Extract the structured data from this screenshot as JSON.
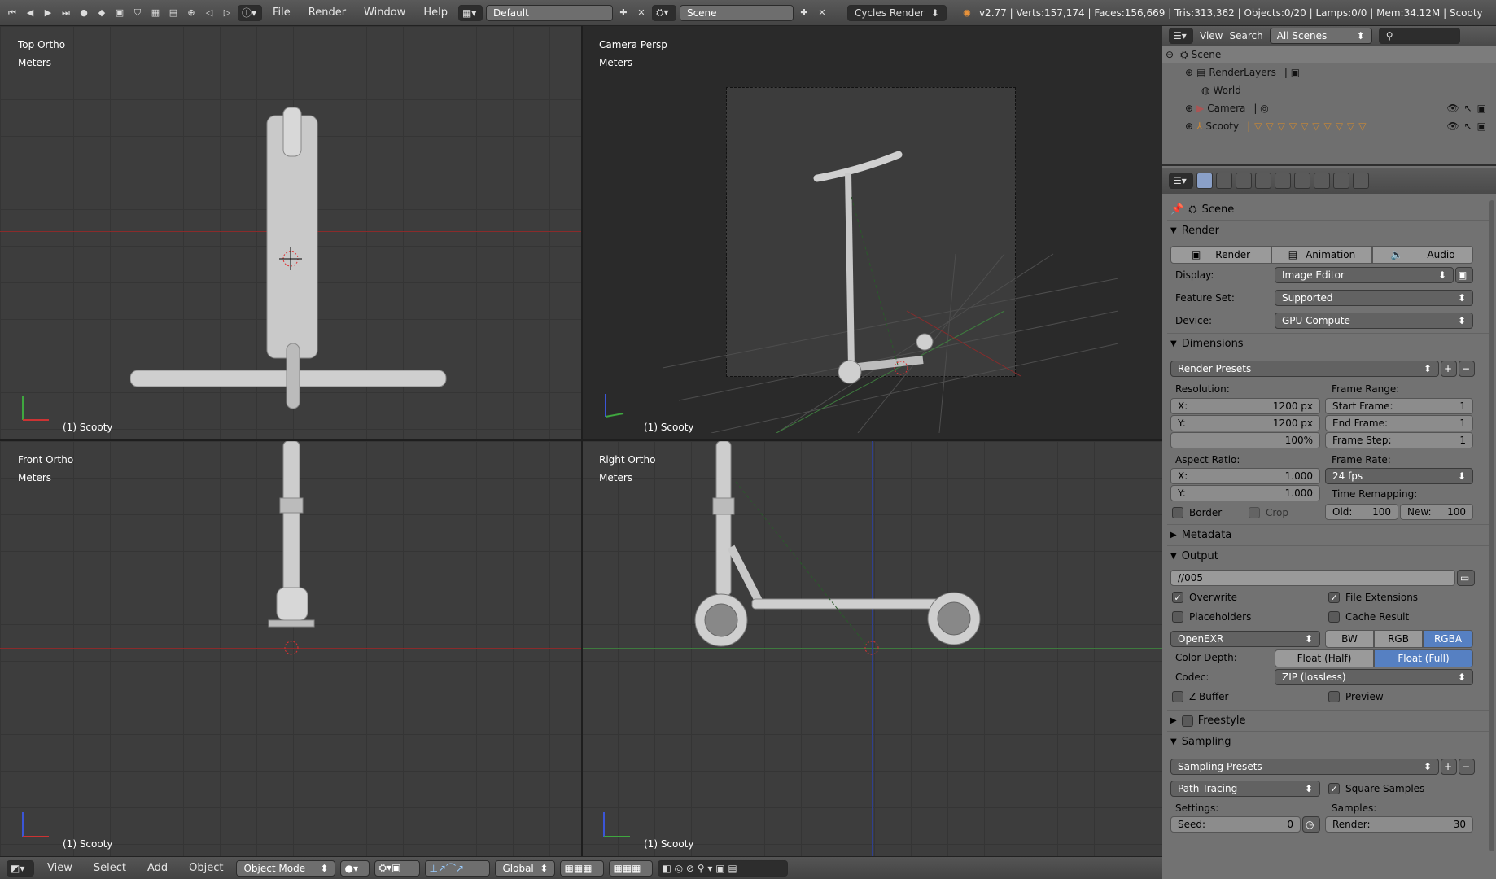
{
  "topbar": {
    "menus": [
      "File",
      "Render",
      "Window",
      "Help"
    ],
    "layout": "Default",
    "scene": "Scene",
    "engine": "Cycles Render",
    "stats": "v2.77 | Verts:157,174 | Faces:156,669 | Tris:313,362 | Objects:0/20 | Lamps:0/0 | Mem:34.12M | Scooty"
  },
  "viewports": [
    {
      "view": "Top Ortho",
      "units": "Meters",
      "object": "(1) Scooty"
    },
    {
      "view": "Camera Persp",
      "units": "Meters",
      "object": "(1) Scooty"
    },
    {
      "view": "Front Ortho",
      "units": "Meters",
      "object": "(1) Scooty"
    },
    {
      "view": "Right Ortho",
      "units": "Meters",
      "object": "(1) Scooty"
    }
  ],
  "bottombar": {
    "menus": [
      "View",
      "Select",
      "Add",
      "Object"
    ],
    "mode": "Object Mode",
    "orientation": "Global"
  },
  "outliner": {
    "view": "View",
    "search": "Search",
    "filter": "All Scenes",
    "items": [
      "Scene",
      "RenderLayers",
      "World",
      "Camera",
      "Scooty"
    ]
  },
  "properties": {
    "context": "Scene",
    "render": {
      "title": "Render",
      "buttons": [
        "Render",
        "Animation",
        "Audio"
      ],
      "display_label": "Display:",
      "display": "Image Editor",
      "feature_label": "Feature Set:",
      "feature": "Supported",
      "device_label": "Device:",
      "device": "GPU Compute"
    },
    "dimensions": {
      "title": "Dimensions",
      "presets": "Render Presets",
      "resolution_label": "Resolution:",
      "res_x": "X:",
      "res_x_val": "1200 px",
      "res_y": "Y:",
      "res_y_val": "1200 px",
      "res_pct": "100%",
      "frame_range_label": "Frame Range:",
      "start": "Start Frame:",
      "start_val": "1",
      "end": "End Frame:",
      "end_val": "1",
      "step": "Frame Step:",
      "step_val": "1",
      "aspect_label": "Aspect Ratio:",
      "asp_x": "X:",
      "asp_x_val": "1.000",
      "asp_y": "Y:",
      "asp_y_val": "1.000",
      "frame_rate_label": "Frame Rate:",
      "frame_rate": "24 fps",
      "remap_label": "Time Remapping:",
      "old": "Old:",
      "old_val": "100",
      "new": "New:",
      "new_val": "100",
      "border": "Border",
      "crop": "Crop"
    },
    "metadata": {
      "title": "Metadata"
    },
    "output": {
      "title": "Output",
      "path": "//005",
      "overwrite": "Overwrite",
      "file_ext": "File Extensions",
      "placeholders": "Placeholders",
      "cache": "Cache Result",
      "format": "OpenEXR",
      "bw": "BW",
      "rgb": "RGB",
      "rgba": "RGBA",
      "depth_label": "Color Depth:",
      "half": "Float (Half)",
      "full": "Float (Full)",
      "codec_label": "Codec:",
      "codec": "ZIP (lossless)",
      "zbuffer": "Z Buffer",
      "preview": "Preview"
    },
    "freestyle": {
      "title": "Freestyle"
    },
    "sampling": {
      "title": "Sampling",
      "presets": "Sampling Presets",
      "integrator": "Path Tracing",
      "square": "Square Samples",
      "settings_label": "Settings:",
      "samples_label": "Samples:",
      "seed": "Seed:",
      "seed_val": "0",
      "render": "Render:",
      "render_val": "30"
    }
  },
  "colors": {
    "accent": "#5680c2",
    "panel": "#727272",
    "viewport": "#3d3d3d"
  }
}
